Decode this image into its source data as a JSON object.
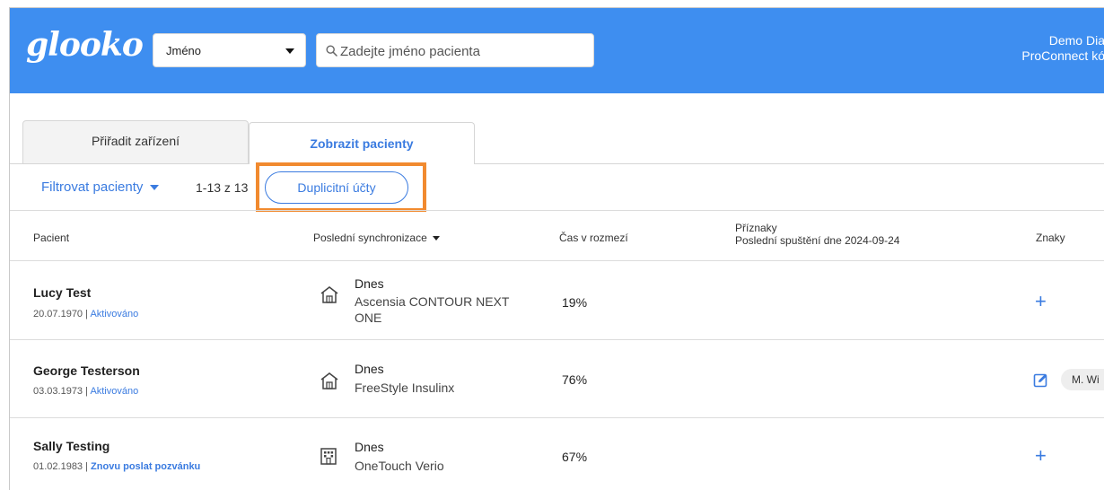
{
  "header": {
    "logo": "glooko",
    "search_by": "Jméno",
    "search_placeholder": "Zadejte jméno pacienta",
    "user_name": "Demo Dia",
    "user_code": "ProConnect kó"
  },
  "tabs": [
    {
      "label": "Přiřadit zařízení",
      "active": false
    },
    {
      "label": "Zobrazit pacienty",
      "active": true
    }
  ],
  "toolbar": {
    "filter_label": "Filtrovat pacienty",
    "count": "1-13 z 13",
    "duplicates_label": "Duplicitní účty"
  },
  "table": {
    "headers": {
      "patient": "Pacient",
      "last_sync": "Poslední synchronizace",
      "tir": "Čas v rozmezí",
      "flags_title": "Příznaky",
      "flags_sub": "Poslední spuštění dne 2024-09-24",
      "tags": "Znaky"
    },
    "rows": [
      {
        "name": "Lucy Test",
        "dob": "20.07.1970",
        "sep": " | ",
        "status": "Aktivováno",
        "sync_when": "Dnes",
        "device": "Ascensia CONTOUR NEXT ONE",
        "device_icon": "home-icon",
        "tir": "19%",
        "tag_action": "plus-icon"
      },
      {
        "name": "George Testerson",
        "dob": "03.03.1973",
        "sep": " | ",
        "status": "Aktivováno",
        "sync_when": "Dnes",
        "device": "FreeStyle Insulinx",
        "device_icon": "home-icon",
        "tir": "76%",
        "tag_action": "edit-icon",
        "tag": "M. Wi"
      },
      {
        "name": "Sally Testing",
        "dob": "01.02.1983",
        "sep": " | ",
        "status": "Znovu poslat pozvánku",
        "sync_when": "Dnes",
        "device": "OneTouch Verio",
        "device_icon": "clinic-building-icon",
        "tir": "67%",
        "tag_action": "plus-icon"
      }
    ]
  },
  "colors": {
    "brand_blue": "#3e8ef0",
    "link_blue": "#3a7be0",
    "highlight_orange": "#f18a2f"
  }
}
